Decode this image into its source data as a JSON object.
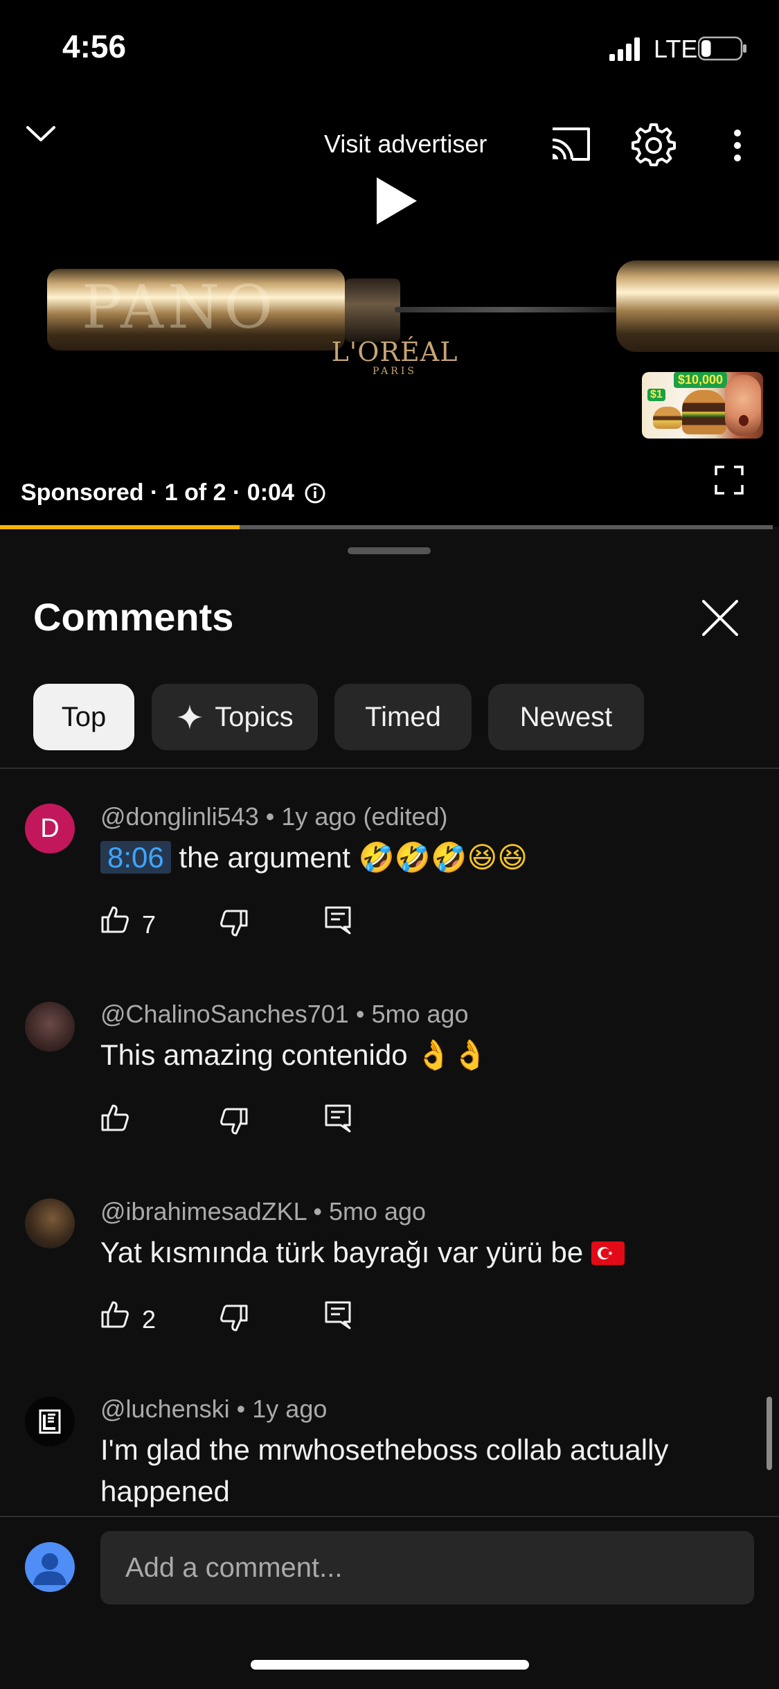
{
  "status_bar": {
    "time": "4:56",
    "network": "LTE",
    "battery_level": 0.25
  },
  "player": {
    "visit_advertiser": "Visit advertiser",
    "ad_info": "Sponsored · 1 of 2 · 0:04",
    "brand_logo": "L'ORÉAL",
    "brand_sub": "PARIS",
    "product_engraving": "PANO",
    "next_thumb": {
      "badge": "$10,000",
      "small_badge": "$1"
    },
    "progress_fraction": 0.31,
    "icons": {
      "collapse": "chevron-down-icon",
      "cast": "cast-icon",
      "settings": "gear-icon",
      "more": "more-vert-icon",
      "play": "play-icon",
      "fullscreen": "fullscreen-icon",
      "info": "info-icon"
    }
  },
  "comments_panel": {
    "title": "Comments",
    "chips": [
      {
        "label": "Top",
        "active": true
      },
      {
        "label": "Topics",
        "active": false,
        "icon": "sparkle-icon"
      },
      {
        "label": "Timed",
        "active": false
      },
      {
        "label": "Newest",
        "active": false
      }
    ],
    "comments": [
      {
        "avatar_letter": "D",
        "avatar_color": "#c2185b",
        "author": "@donglinli543",
        "age": "1y ago (edited)",
        "timestamp_link": "8:06",
        "text": "the argument",
        "emojis": "🤣🤣🤣😆😆",
        "likes": "7"
      },
      {
        "author": "@ChalinoSanches701",
        "age": "5mo ago",
        "text": "This amazing contenido",
        "emojis": "👌👌",
        "likes": ""
      },
      {
        "author": "@ibrahimesadZKL",
        "age": "5mo ago",
        "text": "Yat kısmında türk bayrağı var yürü be",
        "flag": "TR",
        "likes": "2"
      },
      {
        "author": "@luchenski",
        "age": "1y ago",
        "text": "I'm glad the mrwhosetheboss collab actually happened"
      }
    ],
    "separator": "•"
  },
  "composer": {
    "placeholder": "Add a comment..."
  },
  "colors": {
    "accent": "#3ea6ff",
    "progress": "#f5b400",
    "background": "#0f0f0f",
    "chip": "#272727"
  }
}
